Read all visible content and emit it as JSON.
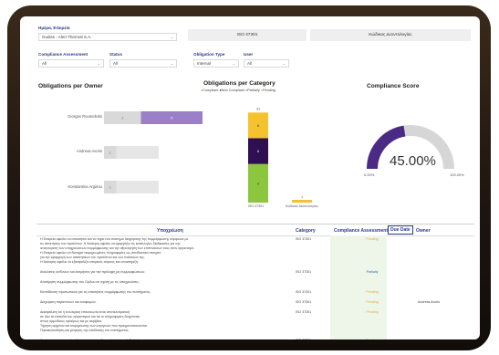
{
  "colors": {
    "compliant": "#8cc63f",
    "non_compliant": "#2e0f52",
    "partially": "#b07be0",
    "pending": "#f3c22e",
    "gauge": "#4b2a86",
    "bar": "#9b7fc9",
    "pale": "#e6e6e6"
  },
  "filters": {
    "company": {
      "label": "Ημέρα, Εταιρεία",
      "value": "Gudiss - Alert Thermal S.A."
    },
    "iso_value": "ISO 37301",
    "scope_value": "Κώδικας Δεοντολογίας",
    "compliance_assessment": {
      "label": "Compliance Assessment",
      "value": "All"
    },
    "status": {
      "label": "Status",
      "value": "All"
    },
    "obligation_type": {
      "label": "Obligation Type",
      "value": "Internal"
    },
    "user": {
      "label": "User",
      "value": "All"
    }
  },
  "owner_chart": {
    "title": "Obligations per Owner",
    "rows": [
      {
        "name": "Giorgos Roumeliotis",
        "values": [
          3,
          5
        ],
        "labels": [
          "3",
          "5"
        ],
        "total": "8"
      },
      {
        "name": "Andreas Avoris",
        "values": [
          1
        ],
        "labels": [
          "1"
        ],
        "total": ""
      },
      {
        "name": "Konstantina Argiriou",
        "values": [
          1
        ],
        "labels": [
          "1"
        ],
        "total": ""
      }
    ],
    "max": 8
  },
  "chart_data": [
    {
      "type": "bar",
      "title": "Obligations per Owner",
      "categories": [
        "Giorgos Roumeliotis",
        "Andreas Avoris",
        "Konstantina Argiriou"
      ],
      "series": [
        {
          "values": [
            3,
            1,
            1
          ]
        },
        {
          "values": [
            5,
            0,
            0
          ]
        }
      ]
    },
    {
      "type": "bar",
      "title": "Obligations per Category",
      "categories": [
        "ISO 37301",
        "Κώδικας Δεοντολογίας"
      ],
      "legend": [
        "Compliant",
        "Non Compliant",
        "Partially",
        "Pending"
      ],
      "series": [
        {
          "name": "Compliant",
          "values": [
            9,
            0
          ]
        },
        {
          "name": "Non Compliant",
          "values": [
            6,
            0
          ]
        },
        {
          "name": "Partially",
          "values": [
            0,
            0
          ]
        },
        {
          "name": "Pending",
          "values": [
            6,
            1
          ]
        }
      ],
      "totals": [
        "31",
        "1"
      ]
    },
    {
      "type": "gauge",
      "title": "Compliance Score",
      "value": 45.0,
      "min_label": "0.00%",
      "max_label": "100.00%",
      "value_label": "45.00%"
    }
  ],
  "category_chart": {
    "title": "Obligations per Category",
    "legend": [
      "Compliant",
      "Non Compliant",
      "Partially",
      "Pending"
    ],
    "total_label": "31",
    "segments": [
      {
        "key": "compliant",
        "label": "9",
        "value": 9
      },
      {
        "key": "non_compliant",
        "label": "6",
        "value": 6
      },
      {
        "key": "pending",
        "label": "6",
        "value": 6
      }
    ],
    "small_bar": {
      "label": "1",
      "value": 1
    },
    "xlabels": [
      "ISO 37301",
      "Κώδικας Δεοντολογίας"
    ]
  },
  "gauge": {
    "title": "Compliance Score",
    "value": "45.00%",
    "min": "0.00%",
    "max": "100.00%",
    "fraction": 0.45
  },
  "table": {
    "headers": {
      "obligation": "Υποχρέωση",
      "category": "Category",
      "assessment": "Compliance Assessment",
      "due": "Due Date",
      "owner": "Owner"
    },
    "rows": [
      {
        "obligation": [
          "Η Εταιρεία οφείλει να αποκτήσει και να τηρεί ένα σύστημα διαχείρισης της συμμόρφωσης σύμφωνα με",
          "τις απαιτήσεις του προτύπου. Η διοίκηση οφείλει να εφαρμόζει τις κατάλληλες διαδικασίες για την",
          "αναγνώριση των υποχρεώσεων συμμόρφωσης και την αξιολόγηση των επιπτώσεων τους στον οργανισμό.",
          "Η Εταιρεία οφείλει να διατηρεί τεκμηριωμένες πληροφορίες ως αποδεικτικό στοιχείο",
          "για την εφαρμογή των απαιτήσεων του προτύπου και των πολιτικών της.",
          "Η διοίκηση οφείλει να εξασφαλίζει επαρκείς πόρους και υποστήριξη."
        ],
        "category": "ISO 37301",
        "assessment": "Pending",
        "status": "pend",
        "owner": ""
      },
      {
        "obligation": [
          "Αναλύσεις κινδύνων και εκτιμήσεις για την πρόληψη μη συμμορφώσεων."
        ],
        "category": "ISO 37301",
        "assessment": "Partially",
        "status": "part",
        "owner": ""
      },
      {
        "obligation": [
          "Αποτίμηση συμμόρφωσης του Ομίλου σε σχέση με τις υποχρεώσεις."
        ],
        "category": "",
        "assessment": "",
        "status": "",
        "owner": ""
      },
      {
        "obligation": [
          "Εκπαίδευση προσωπικού για τις απαιτήσεις συμμόρφωσης του συστήματος."
        ],
        "category": "ISO 37301",
        "assessment": "Pending",
        "status": "pend",
        "owner": ""
      },
      {
        "obligation": [
          "Διαχείριση παραπόνων και αναφορών."
        ],
        "category": "ISO 37301",
        "assessment": "Pending",
        "status": "pend",
        "owner": "Andreas Avoris"
      },
      {
        "obligation": [
          "Διασφάλιση ότι η εσωτερική επικοινωνία είναι αποτελεσματική",
          "σε όλα τα επίπεδα του οργανισμού και ότι οι πληροφορίες διαχέονται",
          "στους αρμόδιους εγκαίρως και με ακρίβεια.",
          "Τήρηση αρχείων και τεκμηρίωσης των ενεργειών που πραγματοποιούνται.",
          "Παρακολούθηση και μέτρηση της απόδοσης του συστήματος."
        ],
        "category": "ISO 37301",
        "assessment": "Pending",
        "status": "pend",
        "owner": ""
      },
      {
        "obligation": [
          "Διενέργεια εσωτερικών ελέγχων σε προκαθορισμένα χρονικά διαστήματα."
        ],
        "category": "ISO 37301",
        "assessment": "Pending",
        "status": "pend",
        "owner": ""
      }
    ]
  }
}
